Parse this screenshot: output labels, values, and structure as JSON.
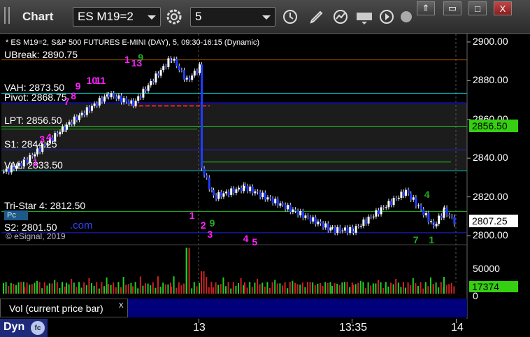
{
  "window": {
    "title": "Chart",
    "symbol": "ES M19=2",
    "interval": "5"
  },
  "toolbar_icons": [
    "gear-icon",
    "clock-icon",
    "pencil-icon",
    "indicator-icon",
    "get-icon",
    "play-icon",
    "link-icon"
  ],
  "window_controls": [
    "⇑",
    "▭",
    "□",
    "X"
  ],
  "chart": {
    "ticker_line": "* ES M19=2, S&P 500 FUTURES E-MINI (DAY), 5, 09:30-16:15 (Dynamic)",
    "y_min": 2795,
    "y_max": 2905,
    "y_ticks": [
      {
        "value": 2900,
        "label": "2900.00"
      },
      {
        "value": 2880,
        "label": "2880.00"
      },
      {
        "value": 2860,
        "label": "2860.00"
      },
      {
        "value": 2840,
        "label": "2840.00"
      },
      {
        "value": 2820,
        "label": "2820.00"
      },
      {
        "value": 2800,
        "label": "2800.00"
      }
    ],
    "levels": [
      {
        "label": "UBreak: 2890.75",
        "value": 2890.75,
        "color": "#aa5500",
        "style": "solid"
      },
      {
        "label": "VAH: 2873.50",
        "value": 2873.5,
        "color": "#00cccc",
        "style": "solid"
      },
      {
        "label": "Pivot: 2868.75",
        "value": 2868.75,
        "color": "#0000dd",
        "style": "solid"
      },
      {
        "label": "LPT: 2856.50",
        "value": 2856.5,
        "color": "#22cc22",
        "style": "solid"
      },
      {
        "label": "S1: 2844.25",
        "value": 2844.25,
        "color": "#2222dd",
        "style": "solid"
      },
      {
        "label": "VAL: 2833.50",
        "value": 2833.5,
        "color": "#00cccc",
        "style": "solid"
      },
      {
        "label": "Tri-Star 4: 2812.50",
        "value": 2812.5,
        "color": "#22bb22",
        "style": "solid"
      },
      {
        "label": "S2: 2801.50",
        "value": 2801.5,
        "color": "#2222dd",
        "style": "solid"
      }
    ],
    "current_price": "2807.25",
    "lpt_badge": "2856.50",
    "copyright": "© eSignal, 2019",
    "pc_box": "Pc",
    "com_text": ".com",
    "td_numbers": [
      {
        "text": "1",
        "color": "#ff22ff",
        "x": 0.07,
        "y": 0.58
      },
      {
        "text": "3",
        "color": "#ff22ff",
        "x": 0.085,
        "y": 0.46
      },
      {
        "text": "4",
        "color": "#ff22ff",
        "x": 0.1,
        "y": 0.45
      },
      {
        "text": "7",
        "color": "#ff22ff",
        "x": 0.14,
        "y": 0.26
      },
      {
        "text": "8",
        "color": "#ff22ff",
        "x": 0.155,
        "y": 0.23
      },
      {
        "text": "9",
        "color": "#ff22ff",
        "x": 0.165,
        "y": 0.18
      },
      {
        "text": "10",
        "color": "#ff22ff",
        "x": 0.19,
        "y": 0.15
      },
      {
        "text": "11",
        "color": "#ff22ff",
        "x": 0.21,
        "y": 0.15
      },
      {
        "text": "13",
        "color": "#ff22ff",
        "x": 0.29,
        "y": 0.06
      },
      {
        "text": "1",
        "color": "#ff22ff",
        "x": 0.275,
        "y": 0.04
      },
      {
        "text": "9",
        "color": "#22aa22",
        "x": 0.305,
        "y": 0.03
      },
      {
        "text": "1",
        "color": "#ff22ff",
        "x": 0.42,
        "y": 0.86
      },
      {
        "text": "2",
        "color": "#ff22ff",
        "x": 0.445,
        "y": 0.91
      },
      {
        "text": "3",
        "color": "#ff22ff",
        "x": 0.46,
        "y": 0.96
      },
      {
        "text": "4",
        "color": "#ff22ff",
        "x": 0.54,
        "y": 0.98
      },
      {
        "text": "5",
        "color": "#ff22ff",
        "x": 0.56,
        "y": 1.0
      },
      {
        "text": "9",
        "color": "#22aa22",
        "x": 0.465,
        "y": 0.9
      },
      {
        "text": "4",
        "color": "#22aa22",
        "x": 0.945,
        "y": 0.75
      },
      {
        "text": "7",
        "color": "#22aa22",
        "x": 0.92,
        "y": 0.99
      },
      {
        "text": "1",
        "color": "#22aa22",
        "x": 0.955,
        "y": 0.99
      }
    ]
  },
  "volume": {
    "label": "Vol (current price bar)",
    "close": "x",
    "y_ticks": [
      {
        "value": 50000,
        "label": "50000"
      },
      {
        "value": 0,
        "label": "0"
      }
    ],
    "current_badge": "17374"
  },
  "time_axis": {
    "labels": [
      "13",
      "13:35",
      "14"
    ]
  },
  "footer": {
    "dyn_label": "Dyn",
    "dyn_icon": "fc"
  }
}
